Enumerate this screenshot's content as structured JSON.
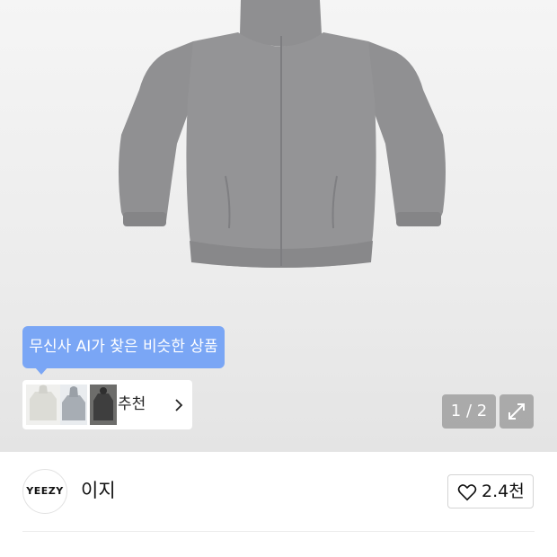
{
  "gallery": {
    "ai_tooltip": "무신사 AI가 찾은 비슷한 상품",
    "recommend_label": "추천",
    "page_indicator": "1 / 2"
  },
  "brand": {
    "logo_text": "YEEZY",
    "name": "이지"
  },
  "like": {
    "count": "2.4천"
  },
  "icons": {
    "recommend": "chevron-right-icon",
    "expand": "expand-icon",
    "like": "heart-icon"
  }
}
